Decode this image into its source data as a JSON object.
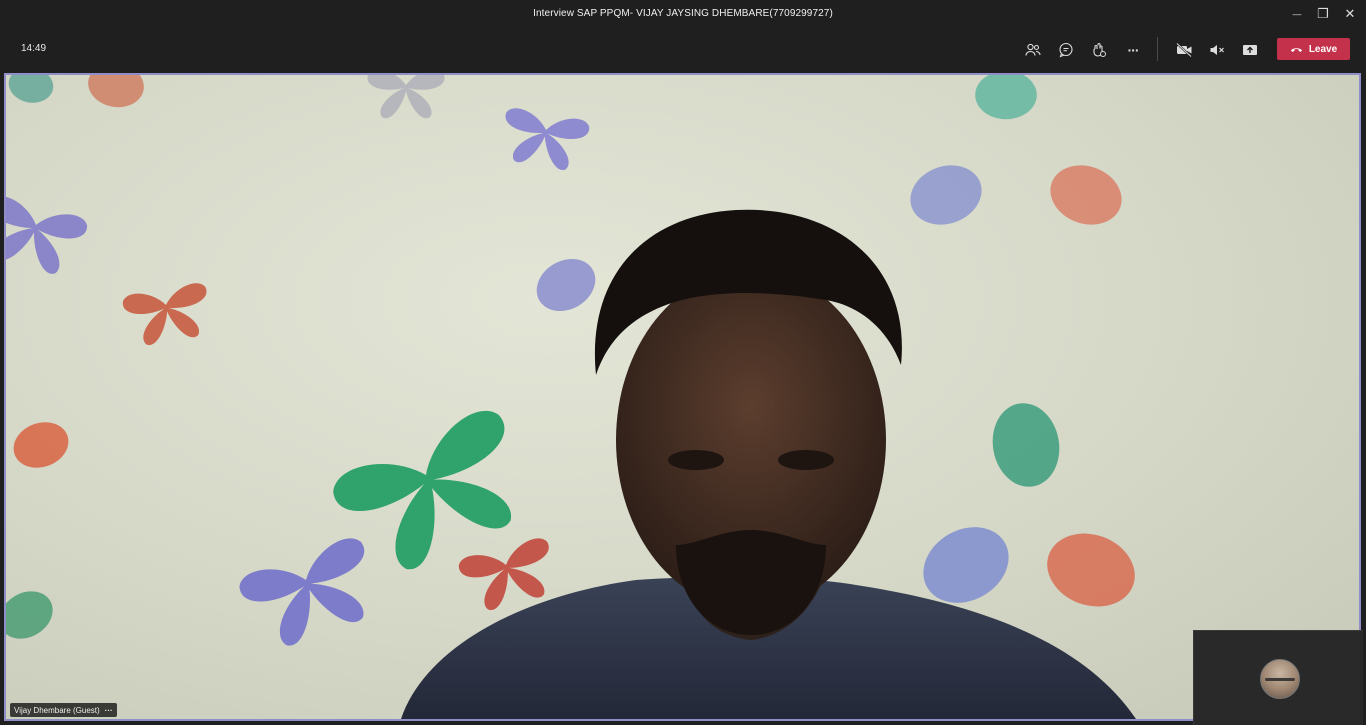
{
  "window": {
    "title": "Interview SAP PPQM- VIJAY JAYSING DHEMBARE(7709299727)",
    "minimize_glyph": "—",
    "restore_glyph": "❐",
    "close_glyph": "✕"
  },
  "toolbar": {
    "clock": "14:49",
    "leave_label": "Leave",
    "more_glyph": "···",
    "icons": [
      "people-icon",
      "chat-icon",
      "reactions-icon",
      "more-icon",
      "camera-off-icon",
      "mic-off-icon",
      "share-screen-icon",
      "phone-hangup-icon"
    ]
  },
  "stage": {
    "participant_name": "Vijay Dhembare (Guest)",
    "name_more_glyph": "···"
  },
  "colors": {
    "background": "#1f1f1f",
    "leave": "#c4314b",
    "active_border": "#8f8ec9",
    "wall": "#d6d8c9"
  }
}
